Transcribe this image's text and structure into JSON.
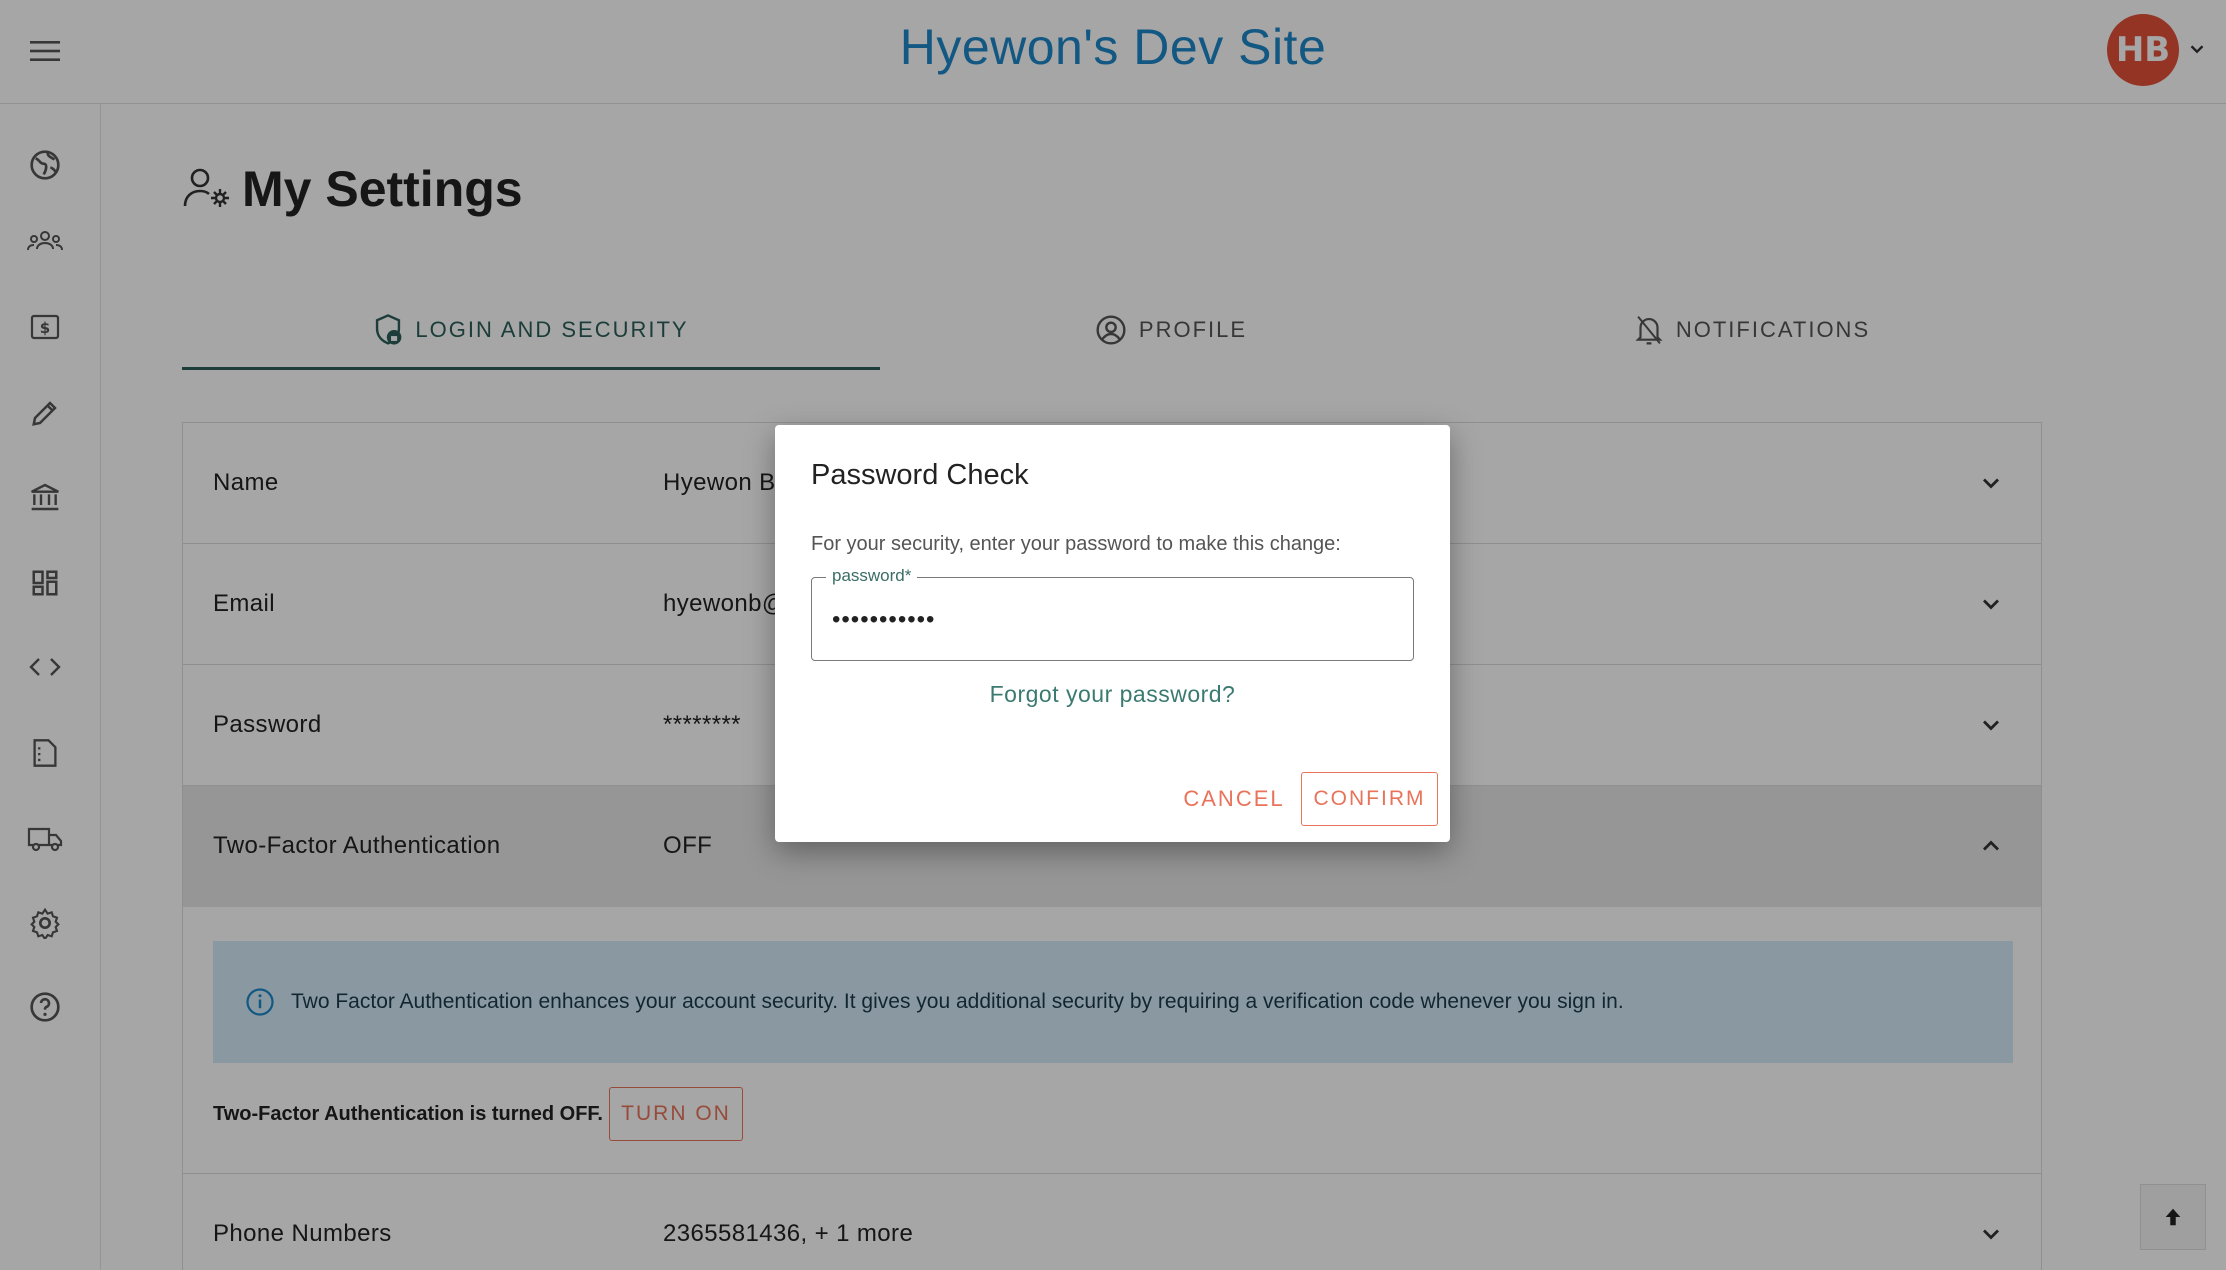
{
  "header": {
    "title": "Hyewon's Dev Site",
    "avatar_initials": "HB"
  },
  "sidebar": {
    "icons": [
      "globe-icon",
      "team-icon",
      "billing-icon",
      "edit-icon",
      "bank-icon",
      "dashboard-icon",
      "code-icon",
      "document-icon",
      "truck-icon",
      "gear-icon",
      "help-icon"
    ]
  },
  "page": {
    "title": "My Settings"
  },
  "tabs": [
    {
      "label": "LOGIN AND SECURITY"
    },
    {
      "label": "PROFILE"
    },
    {
      "label": "NOTIFICATIONS"
    }
  ],
  "rows": [
    {
      "label": "Name",
      "value": "Hyewon B"
    },
    {
      "label": "Email",
      "value": "hyewonb@"
    },
    {
      "label": "Password",
      "value": "********"
    },
    {
      "label": "Two-Factor Authentication",
      "value": "OFF"
    },
    {
      "label": "Phone Numbers",
      "value": "2365581436, + 1 more"
    }
  ],
  "tfa": {
    "info": "Two Factor Authentication enhances your account security. It gives you additional security by requiring a verification code whenever you sign in.",
    "status": "Two-Factor Authentication is turned OFF.",
    "turn_on": "TURN ON"
  },
  "dialog": {
    "title": "Password Check",
    "description": "For your security, enter your password to make this change:",
    "field_label": "password*",
    "field_value": "•••••••••••",
    "forgot": "Forgot your password?",
    "cancel": "CANCEL",
    "confirm": "CONFIRM"
  },
  "colors": {
    "accent": "#e9735a",
    "brand": "#1e88c9",
    "teal": "#2c5f5a",
    "avatar": "#e2513a"
  }
}
